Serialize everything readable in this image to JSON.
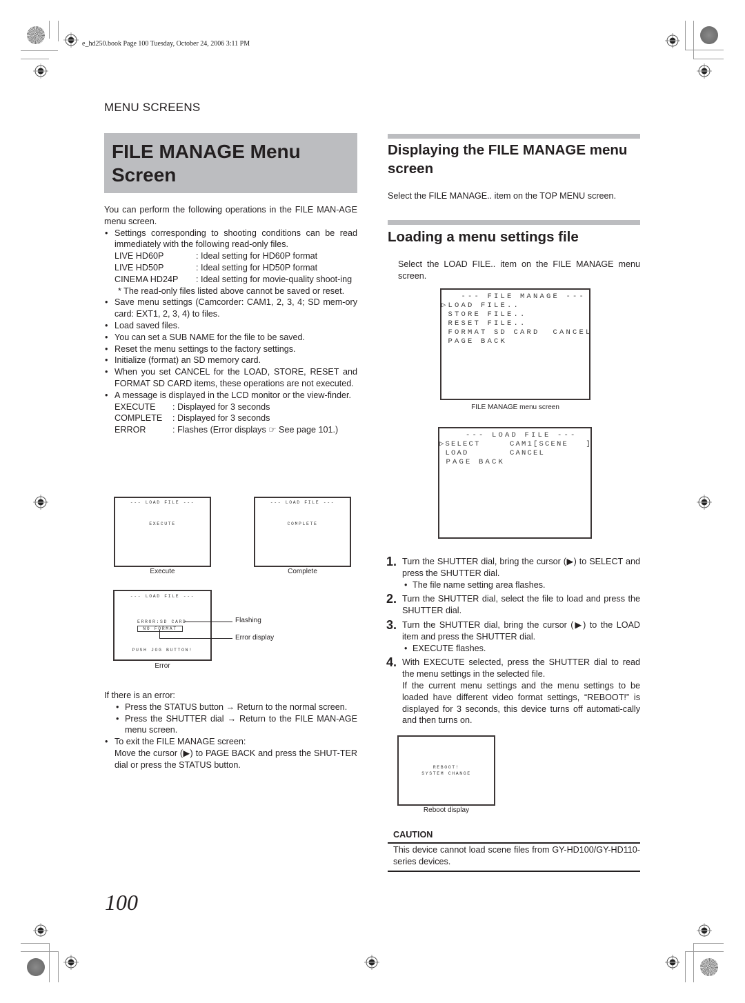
{
  "slug": "e_hd250.book  Page 100  Tuesday, October 24, 2006  3:11 PM",
  "section_label": "MENU SCREENS",
  "title": {
    "line1": "FILE MANAGE Menu",
    "line2": "Screen"
  },
  "left": {
    "intro": "You can perform the following operations in the FILE MAN-AGE menu screen.",
    "bullet1": "Settings corresponding to shooting conditions can be read immediately with the following read-only files.",
    "readonly_files": [
      {
        "name": "LIVE HD60P",
        "desc": ": Ideal setting for HD60P format"
      },
      {
        "name": "LIVE HD50P",
        "desc": ": Ideal setting for HD50P format"
      },
      {
        "name": "CINEMA HD24P",
        "desc": ": Ideal setting for movie-quality shoot-ing"
      }
    ],
    "readonly_note": "* The read-only files listed above cannot be saved or reset.",
    "bullets": [
      "Save menu settings (Camcorder: CAM1, 2, 3, 4; SD mem-ory card: EXT1, 2, 3, 4) to files.",
      "Load saved files.",
      "You can set a SUB NAME for the file to be saved.",
      "Reset the menu settings to the factory settings.",
      "Initialize (format) an SD memory card.",
      "When you set CANCEL for the LOAD, STORE, RESET and FORMAT SD CARD items, these operations are not executed.",
      "A message is displayed in the LCD monitor or the view-finder."
    ],
    "messages": [
      {
        "name": "EXECUTE",
        "desc": ": Displayed for 3 seconds"
      },
      {
        "name": "COMPLETE",
        "desc": ": Displayed for 3 seconds"
      },
      {
        "name": "ERROR",
        "desc": ": Flashes (Error displays ☞ See page 101.)"
      }
    ],
    "screens": {
      "execute": {
        "header": "--- LOAD FILE ---",
        "body": "EXECUTE",
        "caption": "Execute"
      },
      "complete": {
        "header": "--- LOAD FILE ---",
        "body": "COMPLETE",
        "caption": "Complete"
      },
      "error": {
        "header": "--- LOAD FILE ---",
        "line1": "ERROR:SD CARD",
        "line2": "NO FORMAT",
        "footer": "PUSH JOG BUTTON!",
        "caption": "Error",
        "callout_flashing": "Flashing",
        "callout_error_display": "Error display"
      }
    },
    "error_intro": "If there is an error:",
    "error_steps": [
      "Press the STATUS button → Return to the normal screen.",
      "Press the SHUTTER dial → Return to the FILE MAN-AGE menu screen."
    ],
    "exit_bullet": "To exit the FILE MANAGE screen:",
    "exit_text": "Move the cursor (▶) to PAGE BACK and press the SHUT-TER dial or press the STATUS button."
  },
  "right": {
    "h_display": "Displaying the FILE MANAGE menu screen",
    "display_text": "Select the FILE MANAGE.. item on the TOP MENU screen.",
    "h_loading": "Loading a menu settings file",
    "loading_text": "Select the LOAD FILE.. item on the FILE MANAGE menu screen.",
    "file_manage_screen": {
      "lines": [
        "   --- FILE MANAGE ---",
        "▷LOAD FILE..",
        " STORE FILE..",
        " RESET FILE..",
        " FORMAT SD CARD  CANCEL",
        " PAGE BACK"
      ],
      "caption": "FILE MANAGE menu screen"
    },
    "load_file_screen": {
      "lines": [
        "    --- LOAD FILE ---",
        "▷SELECT     CAM1[SCENE   ]",
        " LOAD       CANCEL",
        " PAGE BACK"
      ]
    },
    "steps": [
      {
        "num": "1.",
        "text": "Turn the SHUTTER dial, bring the cursor (▶) to SELECT and press the SHUTTER dial.",
        "sub": "The file name setting area flashes."
      },
      {
        "num": "2.",
        "text": "Turn the SHUTTER dial, select the file to load and press the SHUTTER dial.",
        "sub": ""
      },
      {
        "num": "3.",
        "text": "Turn the SHUTTER dial, bring the cursor (▶) to the LOAD item and press the SHUTTER dial.",
        "sub": "EXECUTE flashes."
      },
      {
        "num": "4.",
        "text": "With EXECUTE selected, press the SHUTTER dial to read the menu settings in the selected file.",
        "extra": "If the current menu settings and the menu settings to be loaded have different video format settings, “REBOOT!” is displayed for 3 seconds, this device turns off automati-cally and then turns on."
      }
    ],
    "reboot_screen": {
      "line1": "REBOOT!",
      "line2": "SYSTEM CHANGE",
      "caption": "Reboot display"
    },
    "caution_title": "CAUTION",
    "caution_text": "This device cannot load scene files from GY-HD100/GY-HD110-series devices."
  },
  "page_number": "100"
}
